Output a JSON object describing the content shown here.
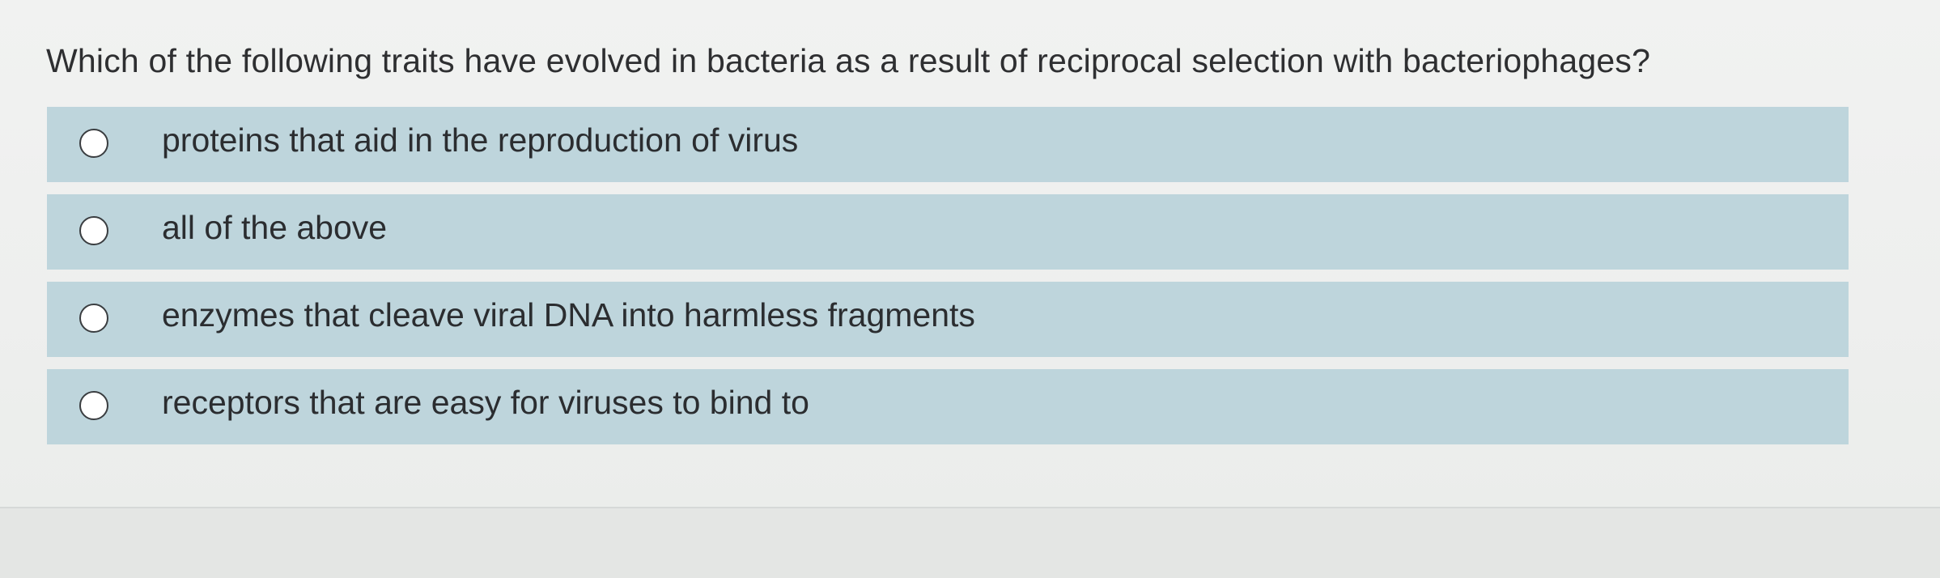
{
  "question": {
    "text": "Which of the following traits have evolved in bacteria as a result of reciprocal selection with bacteriophages?"
  },
  "options": [
    {
      "label": "proteins that aid in the reproduction of virus",
      "selected": false
    },
    {
      "label": "all of the above",
      "selected": false
    },
    {
      "label": "enzymes that cleave viral DNA into harmless fragments",
      "selected": false
    },
    {
      "label": "receptors that are easy for viruses to bind to",
      "selected": false
    }
  ],
  "colors": {
    "option_background": "#bed5dc",
    "page_background": "#eeefee",
    "text": "#2e2f31"
  }
}
